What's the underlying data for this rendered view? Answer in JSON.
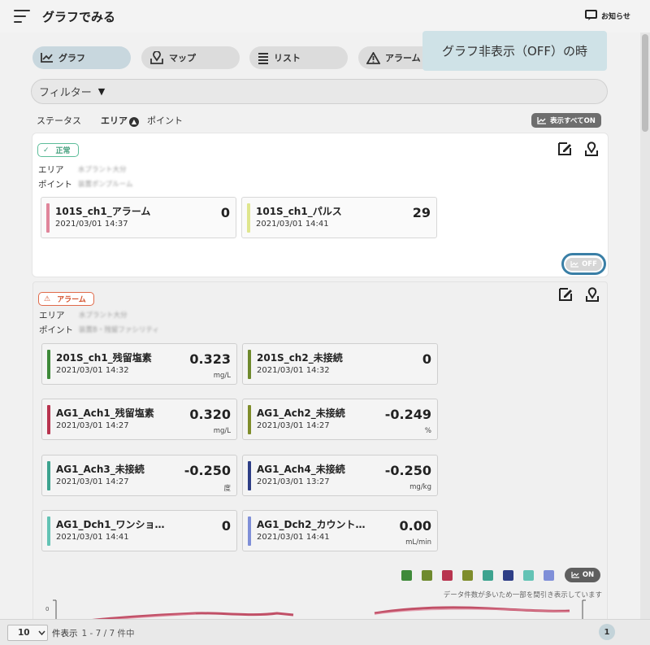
{
  "header": {
    "title": "グラフでみる",
    "notice_label": "お知らせ"
  },
  "tabs": [
    {
      "label": "グラフ",
      "icon": "chart-icon"
    },
    {
      "label": "マップ",
      "icon": "map-pin-icon"
    },
    {
      "label": "リスト",
      "icon": "list-icon"
    },
    {
      "label": "アラーム",
      "icon": "warning-icon"
    }
  ],
  "filter": {
    "label": "フィルター",
    "arrow": "▼"
  },
  "sort": {
    "status": "ステータス",
    "area": "エリア",
    "area_arrow": "▲",
    "point": "ポイント"
  },
  "show_all_label": "表示すべてON",
  "tooltip": "グラフ非表示（OFF）の時",
  "card1": {
    "status": "正常",
    "status_mark": "✓",
    "area_label": "エリア",
    "area_value": "水プラント大分",
    "point_label": "ポイント",
    "point_value": "装置ポンプルーム",
    "tiles": [
      {
        "name": "101S_ch1_アラーム",
        "date": "2021/03/01 14:37",
        "value": "0",
        "unit": "",
        "color": "#e0869b"
      },
      {
        "name": "101S_ch1_パルス",
        "date": "2021/03/01 14:41",
        "value": "29",
        "unit": "",
        "color": "#dfe68e"
      }
    ],
    "toggle_label": "OFF"
  },
  "card2": {
    "status": "アラーム",
    "status_mark": "⚠",
    "area_label": "エリア",
    "area_value": "水プラント大分",
    "point_label": "ポイント",
    "point_value": "装置B・残留ファシリティ",
    "tiles": [
      {
        "name": "201S_ch1_残留塩素",
        "date": "2021/03/01 14:32",
        "value": "0.323",
        "unit": "mg/L",
        "color": "#3f8a3a"
      },
      {
        "name": "201S_ch2_未接続",
        "date": "2021/03/01 14:32",
        "value": "0",
        "unit": "",
        "color": "#6f8a2e"
      },
      {
        "name": "AG1_Ach1_残留塩素",
        "date": "2021/03/01 14:27",
        "value": "0.320",
        "unit": "mg/L",
        "color": "#b8344f"
      },
      {
        "name": "AG1_Ach2_未接続",
        "date": "2021/03/01 14:27",
        "value": "-0.249",
        "unit": "%",
        "color": "#7f8d2b"
      },
      {
        "name": "AG1_Ach3_未接続",
        "date": "2021/03/01 14:27",
        "value": "-0.250",
        "unit": "度",
        "color": "#3da38f"
      },
      {
        "name": "AG1_Ach4_未接続",
        "date": "2021/03/01 13:27",
        "value": "-0.250",
        "unit": "mg/kg",
        "color": "#2e3e86"
      },
      {
        "name": "AG1_Dch1_ワンショ…",
        "date": "2021/03/01 14:41",
        "value": "0",
        "unit": "",
        "color": "#63c3b5"
      },
      {
        "name": "AG1_Dch2_カウント…",
        "date": "2021/03/01 14:41",
        "value": "0.00",
        "unit": "mL/min",
        "color": "#7f8fd8"
      }
    ],
    "toggle_label": "ON",
    "sample_note": "データ件数が多いため一部を間引き表示しています",
    "axis_zero": "0"
  },
  "footer": {
    "per_page": "10",
    "per_page_label": "件表示",
    "range": "1 - 7 / 7 件中",
    "page": "1"
  }
}
